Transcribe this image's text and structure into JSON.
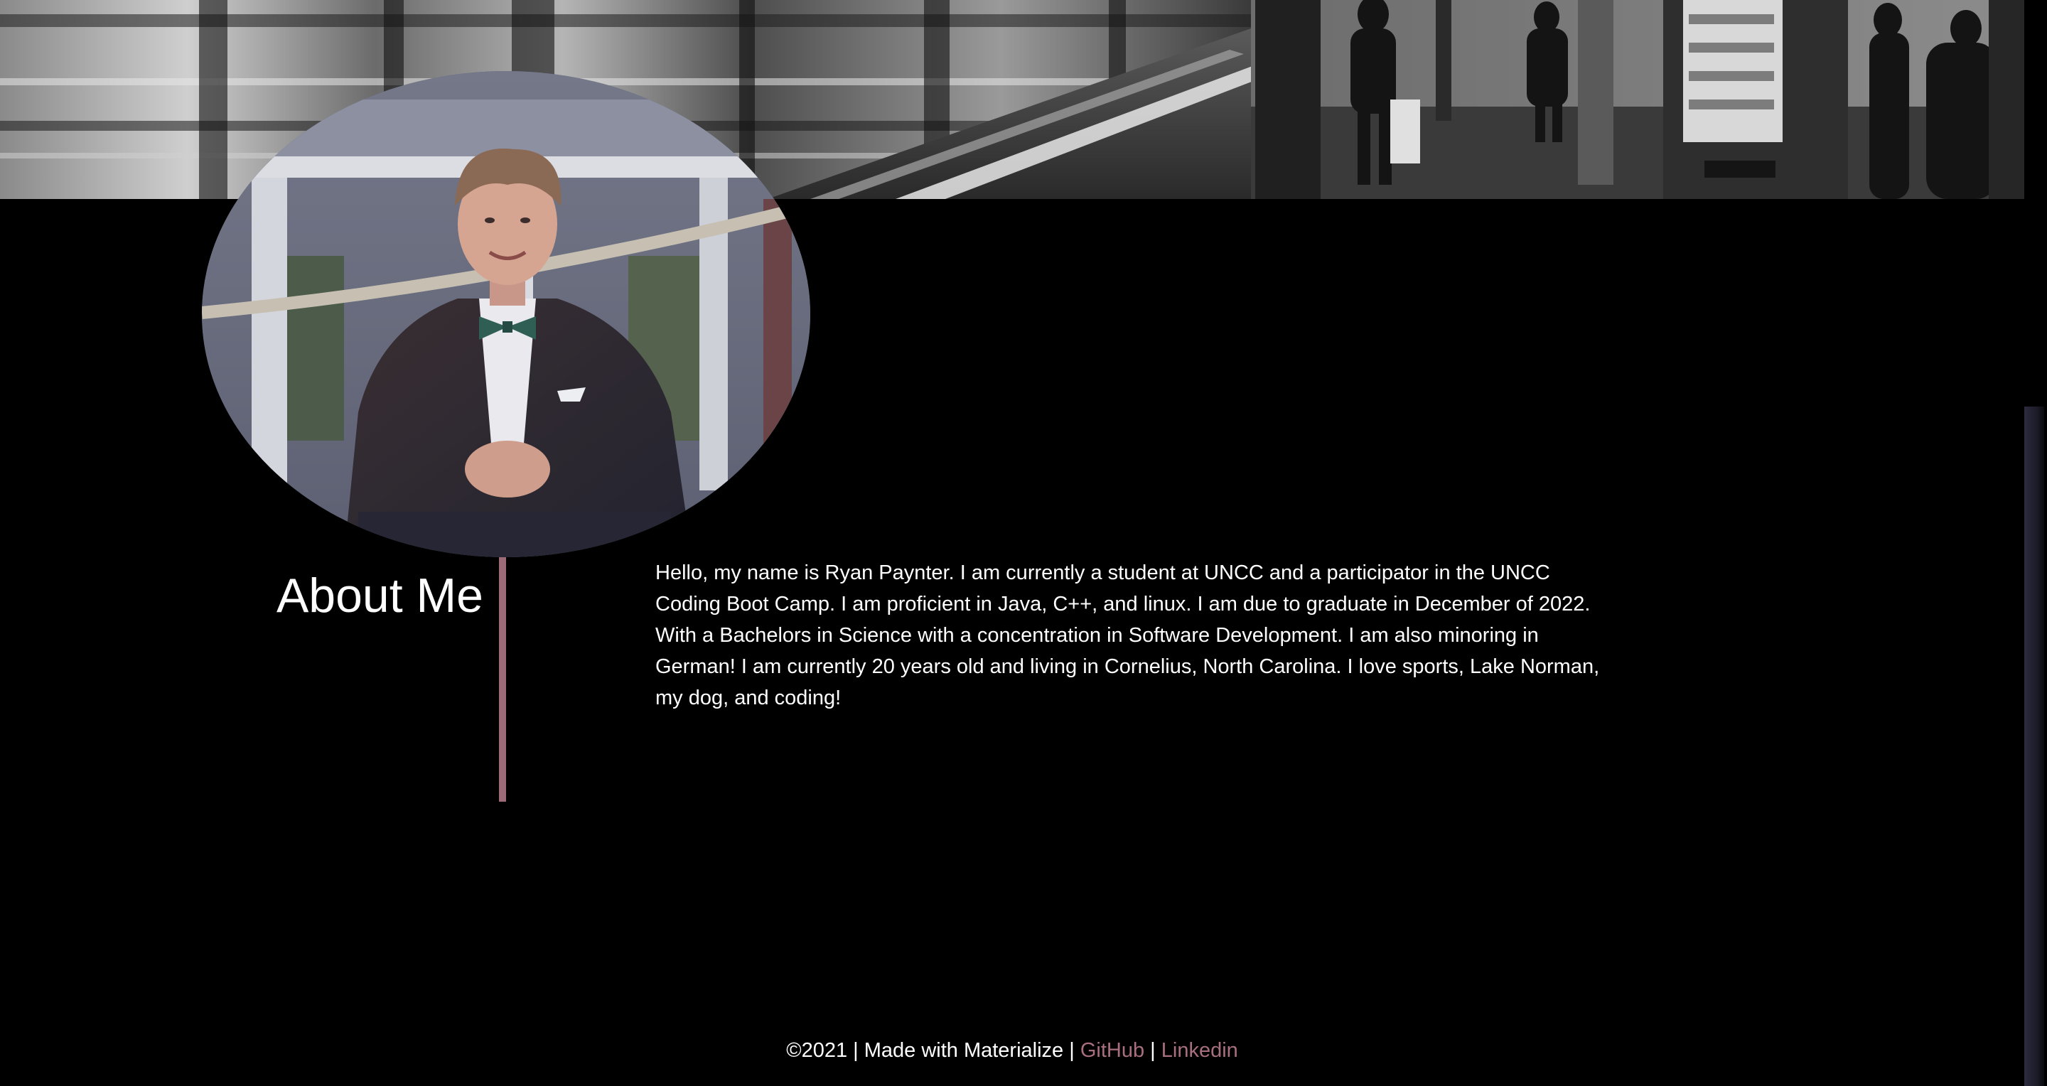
{
  "theme": {
    "background": "#000000",
    "accent": "#9d6a77",
    "link_color": "#a86f7e",
    "text_color": "#ffffff"
  },
  "hero": {
    "image": "grayscale-subway-platform-photo"
  },
  "profile": {
    "image": "profile-photo-man-in-suit-bowtie"
  },
  "about": {
    "title": "About Me",
    "body": "Hello, my name is Ryan Paynter. I am currently a student at UNCC and a participator in the UNCC Coding Boot Camp. I am proficient in Java, C++, and linux. I am due to graduate in December of 2022. With a Bachelors in Science with a concentration in Software Development. I am also minoring in German! I am currently 20 years old and living in Cornelius, North Carolina. I love sports, Lake Norman, my dog, and coding!"
  },
  "footer": {
    "prefix": "©2021 | Made with Materialize |",
    "github_label": "GitHub",
    "separator": "|",
    "linkedin_label": "Linkedin"
  }
}
